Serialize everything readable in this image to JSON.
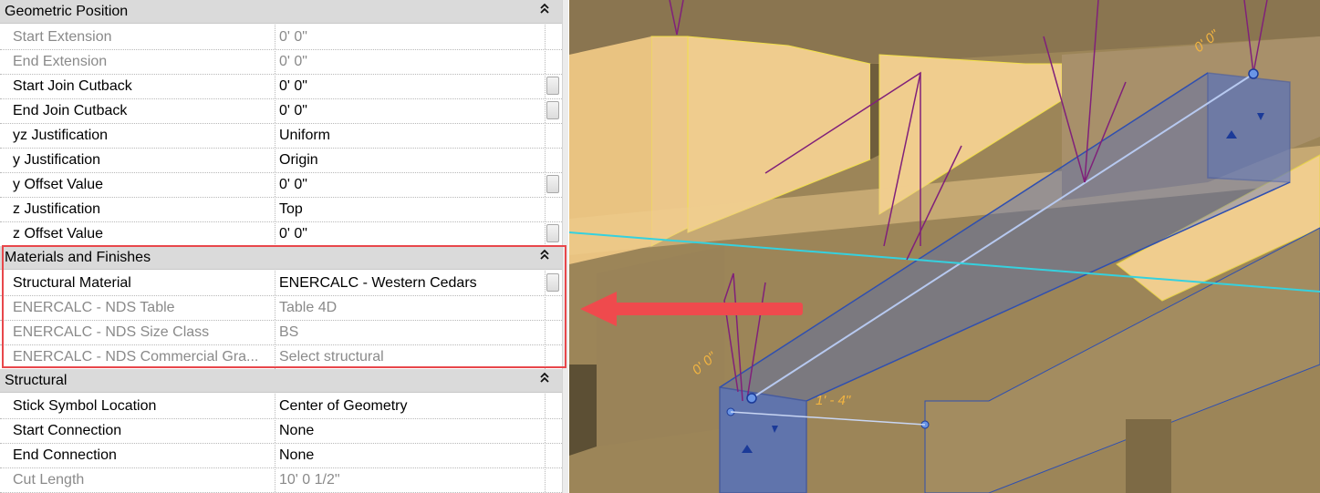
{
  "properties": {
    "sections": [
      {
        "title": "Geometric Position",
        "collapse_icon": "double-chevron-up-icon",
        "rows": [
          {
            "name": "Start Extension",
            "value": "0'  0\"",
            "disabled": true
          },
          {
            "name": "End Extension",
            "value": "0'  0\"",
            "disabled": true
          },
          {
            "name": "Start Join Cutback",
            "value": "0'  0\"",
            "disabled": false,
            "button": true
          },
          {
            "name": "End Join Cutback",
            "value": "0'  0\"",
            "disabled": false,
            "button": true
          },
          {
            "name": "yz Justification",
            "value": "Uniform",
            "disabled": false
          },
          {
            "name": "y Justification",
            "value": "Origin",
            "disabled": false
          },
          {
            "name": "y Offset Value",
            "value": "0'  0\"",
            "disabled": false,
            "button": true
          },
          {
            "name": "z Justification",
            "value": "Top",
            "disabled": false
          },
          {
            "name": "z Offset Value",
            "value": "0'  0\"",
            "disabled": false,
            "button": true
          }
        ]
      },
      {
        "title": "Materials and Finishes",
        "collapse_icon": "double-chevron-up-icon",
        "rows": [
          {
            "name": "Structural Material",
            "value": "ENERCALC - Western Cedars",
            "disabled": false,
            "button": true
          },
          {
            "name": "ENERCALC - NDS Table",
            "value": "Table 4D",
            "disabled": true
          },
          {
            "name": "ENERCALC - NDS Size Class",
            "value": "BS",
            "disabled": true
          },
          {
            "name": "ENERCALC - NDS Commercial Gra...",
            "value": "Select structural",
            "disabled": true
          }
        ]
      },
      {
        "title": "Structural",
        "collapse_icon": "double-chevron-up-icon",
        "rows": [
          {
            "name": "Stick Symbol Location",
            "value": "Center of Geometry",
            "disabled": false
          },
          {
            "name": "Start Connection",
            "value": "None",
            "disabled": false
          },
          {
            "name": "End Connection",
            "value": "None",
            "disabled": false
          },
          {
            "name": "Cut Length",
            "value": "10'  0 1/2\"",
            "disabled": true
          }
        ]
      }
    ]
  },
  "viewport": {
    "dimension_top": "0' 0\"",
    "dimension_left": "0' 0\"",
    "dimension_length": "1' - 4\"",
    "colors": {
      "wood": "#f0cd8e",
      "wood_dark": "#9c8558",
      "selection": "#3f63c9",
      "highlight": "#e8474b",
      "lines": "#80207a"
    }
  },
  "annotation": {
    "arrow_icon": "red-arrow-left-icon"
  }
}
